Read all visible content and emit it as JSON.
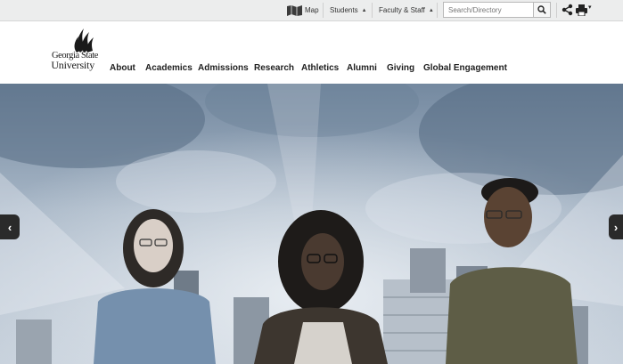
{
  "utility": {
    "map_label": "Map",
    "students_label": "Students",
    "faculty_label": "Faculty & Staff",
    "search_placeholder": "Search/Directory",
    "icons": [
      "map-icon",
      "search-icon",
      "share-icon",
      "print-icon"
    ]
  },
  "logo": {
    "line1": "Georgia State",
    "line2": "University"
  },
  "nav": {
    "items": [
      "About",
      "Academics",
      "Admissions",
      "Research",
      "Athletics",
      "Alumni",
      "Giving",
      "Global Engagement"
    ]
  },
  "hero": {
    "prev_icon": "chevron-left-icon",
    "next_icon": "chevron-right-icon"
  },
  "colors": {
    "utility_bg": "#eceded",
    "hero_sky": "#8fa2b6",
    "arrow_bg": "#2a2a2a"
  }
}
